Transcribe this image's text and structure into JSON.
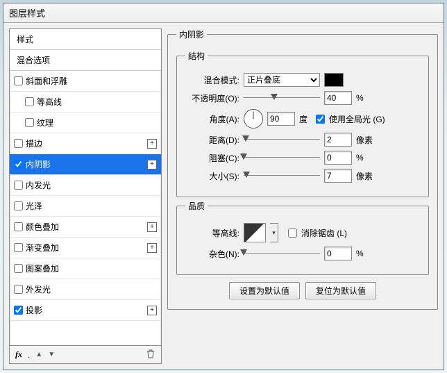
{
  "window": {
    "title": "图层样式"
  },
  "left": {
    "header_styles": "样式",
    "header_blend": "混合选项",
    "items": [
      {
        "label": "斜面和浮雕",
        "checked": false,
        "plus": false,
        "indent": false
      },
      {
        "label": "等高线",
        "checked": false,
        "plus": false,
        "indent": true
      },
      {
        "label": "纹理",
        "checked": false,
        "plus": false,
        "indent": true
      },
      {
        "label": "描边",
        "checked": false,
        "plus": true,
        "indent": false
      },
      {
        "label": "内阴影",
        "checked": true,
        "plus": true,
        "indent": false,
        "selected": true
      },
      {
        "label": "内发光",
        "checked": false,
        "plus": false,
        "indent": false
      },
      {
        "label": "光泽",
        "checked": false,
        "plus": false,
        "indent": false
      },
      {
        "label": "颜色叠加",
        "checked": false,
        "plus": true,
        "indent": false
      },
      {
        "label": "渐变叠加",
        "checked": false,
        "plus": true,
        "indent": false
      },
      {
        "label": "图案叠加",
        "checked": false,
        "plus": false,
        "indent": false
      },
      {
        "label": "外发光",
        "checked": false,
        "plus": false,
        "indent": false
      },
      {
        "label": "投影",
        "checked": true,
        "plus": true,
        "indent": false
      }
    ],
    "footer_fx": "fx"
  },
  "right": {
    "panel_title": "内阴影",
    "structure": {
      "legend": "结构",
      "blend_mode_label": "混合模式:",
      "blend_mode_value": "正片叠底",
      "opacity_label": "不透明度(O):",
      "opacity_value": "40",
      "opacity_unit": "%",
      "angle_label": "角度(A):",
      "angle_value": "90",
      "angle_unit": "度",
      "global_light_label": "使用全局光 (G)",
      "global_light_checked": true,
      "distance_label": "距离(D):",
      "distance_value": "2",
      "distance_unit": "像素",
      "choke_label": "阻塞(C):",
      "choke_value": "0",
      "choke_unit": "%",
      "size_label": "大小(S):",
      "size_value": "7",
      "size_unit": "像素"
    },
    "quality": {
      "legend": "品质",
      "contour_label": "等高线:",
      "antialias_label": "消除锯齿 (L)",
      "antialias_checked": false,
      "noise_label": "杂色(N):",
      "noise_value": "0",
      "noise_unit": "%"
    },
    "buttons": {
      "set_default": "设置为默认值",
      "reset_default": "复位为默认值"
    }
  }
}
